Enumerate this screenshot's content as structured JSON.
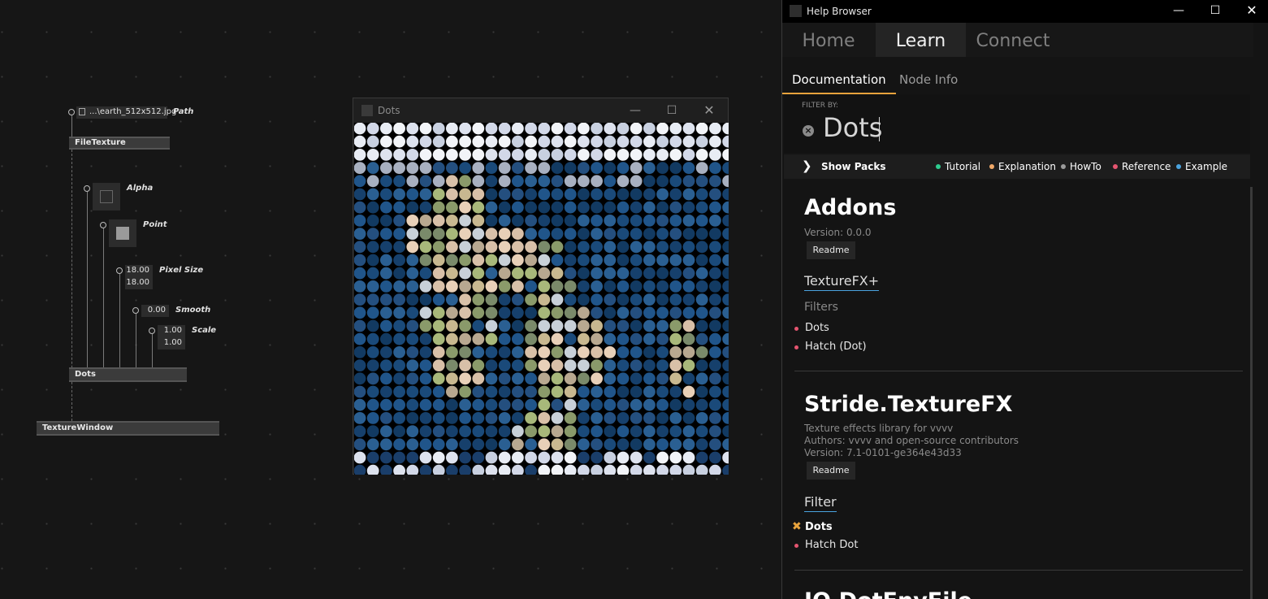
{
  "patch": {
    "file_path_value": "...\\earth_512x512.jpg",
    "file_path_label": "Path",
    "file_texture_node": "FileTexture",
    "alpha_label": "Alpha",
    "point_label": "Point",
    "pixel_size_label": "Pixel Size",
    "pixel_size_x": "18.00",
    "pixel_size_y": "18.00",
    "smooth_label": "Smooth",
    "smooth_value": "0.00",
    "scale_label": "Scale",
    "scale_x": "1.00",
    "scale_y": "1.00",
    "dots_node": "Dots",
    "texture_window_node": "TextureWindow"
  },
  "render_window": {
    "title": "Dots"
  },
  "help_browser": {
    "title": "Help Browser",
    "main_tabs": [
      "Home",
      "Learn",
      "Connect"
    ],
    "sub_tabs": [
      "Documentation",
      "Node Info"
    ],
    "filter_label": "FILTER BY:",
    "filter_value": "Dots",
    "show_packs": "Show Packs",
    "legend": [
      {
        "label": "Tutorial",
        "color": "#2ecc8f"
      },
      {
        "label": "Explanation",
        "color": "#f0a868"
      },
      {
        "label": "HowTo",
        "color": "#9a9a9a"
      },
      {
        "label": "Reference",
        "color": "#e55570"
      },
      {
        "label": "Example",
        "color": "#4aa3df"
      }
    ],
    "packs": [
      {
        "name": "Addons",
        "version": "Version: 0.0.0",
        "readme": "Readme",
        "category": "TextureFX+",
        "subcategory": "Filters",
        "items": [
          "Dots",
          "Hatch (Dot)"
        ]
      },
      {
        "name": "Stride.TextureFX",
        "description": "Texture effects library for vvvv",
        "authors": "Authors: vvvv and open-source contributors",
        "version": "Version: 7.1-0101-ge364e43d33",
        "readme": "Readme",
        "category": "Filter",
        "items": [
          "Dots",
          "Hatch Dot"
        ]
      },
      {
        "name": "IO.DotEnvFile"
      }
    ]
  }
}
